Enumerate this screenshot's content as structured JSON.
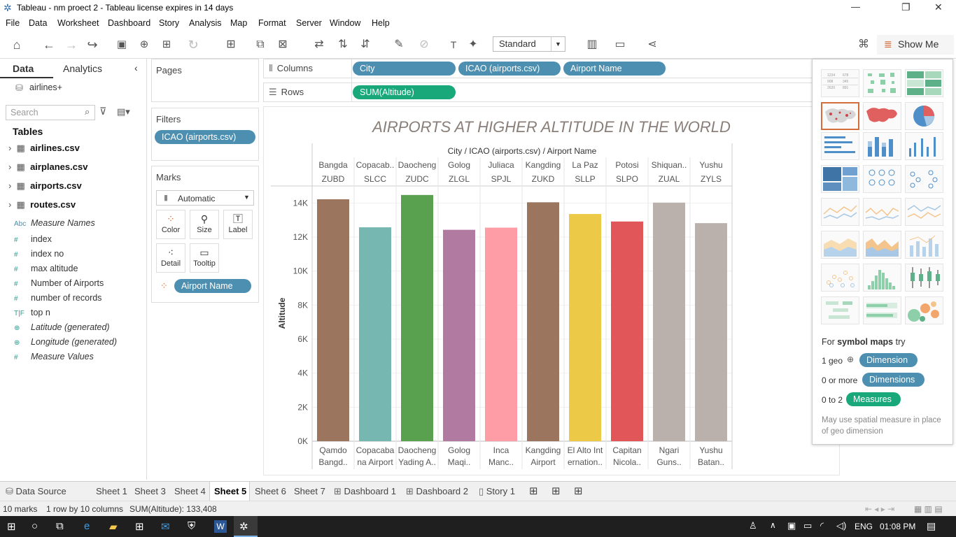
{
  "window": {
    "title": "Tableau - nm proect 2 - Tableau license expires in 14 days",
    "minimize": "—",
    "restore": "❐",
    "close": "✕"
  },
  "menu": [
    "File",
    "Data",
    "Worksheet",
    "Dashboard",
    "Story",
    "Analysis",
    "Map",
    "Format",
    "Server",
    "Window",
    "Help"
  ],
  "toolbar": {
    "fit_select": "Standard",
    "show_me_label": "Show Me"
  },
  "left_pane": {
    "tabs": [
      "Data",
      "Analytics"
    ],
    "datasource": "airlines+",
    "search_placeholder": "Search",
    "tables_heading": "Tables",
    "tables": [
      "airlines.csv",
      "airplanes.csv",
      "airports.csv",
      "routes.csv"
    ],
    "fields": [
      {
        "icon": "Abc",
        "label": "Measure Names",
        "italic": true
      },
      {
        "icon": "#",
        "label": "index",
        "italic": false
      },
      {
        "icon": "#",
        "label": "index no",
        "italic": false
      },
      {
        "icon": "#",
        "label": "max altitude",
        "italic": false
      },
      {
        "icon": "#",
        "label": "Number of Airports",
        "italic": false
      },
      {
        "icon": "#",
        "label": "number of records",
        "italic": false
      },
      {
        "icon": "T|F",
        "label": "top n",
        "italic": false
      },
      {
        "icon": "⊕",
        "label": "Latitude (generated)",
        "italic": true
      },
      {
        "icon": "⊕",
        "label": "Longitude (generated)",
        "italic": true
      },
      {
        "icon": "#",
        "label": "Measure Values",
        "italic": true
      }
    ]
  },
  "cards": {
    "pages": "Pages",
    "filters": "Filters",
    "filter_pill": "ICAO (airports.csv)",
    "marks": "Marks",
    "mark_type": "Automatic",
    "mark_buttons": [
      "Color",
      "Size",
      "Label",
      "Detail",
      "Tooltip"
    ],
    "color_pill": "Airport Name"
  },
  "shelves": {
    "columns_label": "Columns",
    "rows_label": "Rows",
    "columns": [
      "City",
      "ICAO (airports.csv)",
      "Airport Name"
    ],
    "rows": [
      "SUM(Altitude)"
    ]
  },
  "chart_data": {
    "type": "bar",
    "title": "AIRPORTS AT HIGHER ALTITUDE IN THE WORLD",
    "header_title": "City / ICAO (airports.csv) / Airport Name",
    "ylabel": "Altitude",
    "ylim": [
      0,
      15000
    ],
    "yticks": [
      "0K",
      "2K",
      "4K",
      "6K",
      "8K",
      "10K",
      "12K",
      "14K"
    ],
    "ytick_values": [
      0,
      2000,
      4000,
      6000,
      8000,
      10000,
      12000,
      14000
    ],
    "cities": [
      "Bangda",
      "Copacab..",
      "Daocheng",
      "Golog",
      "Juliaca",
      "Kangding",
      "La Paz",
      "Potosi",
      "Shiquan..",
      "Yushu"
    ],
    "icao": [
      "ZUBD",
      "SLCC",
      "ZUDC",
      "ZLGL",
      "SPJL",
      "ZUKD",
      "SLLP",
      "SLPO",
      "ZUAL",
      "ZYLS"
    ],
    "airport_line1": [
      "Qamdo",
      "Copacaba",
      "Daocheng",
      "Golog",
      "Inca",
      "Kangding",
      "El Alto Int",
      "Capitan",
      "Ngari",
      "Yushu"
    ],
    "airport_line2": [
      "Bangd..",
      "na Airport",
      "Yading A..",
      "Maqi..",
      "Manc..",
      "Airport",
      "ernation..",
      "Nicola..",
      "Guns..",
      "Batan.."
    ],
    "values": [
      14219,
      12572,
      14472,
      12426,
      12552,
      14042,
      13355,
      12913,
      14022,
      12816
    ],
    "colors": [
      "#9c755f",
      "#76b7b2",
      "#59a14f",
      "#b07aa1",
      "#ff9da7",
      "#9c755f",
      "#edc948",
      "#e15759",
      "#bab0ac",
      "#bab0ac"
    ]
  },
  "show_me": {
    "hint_prefix": "For ",
    "hint_bold": "symbol maps",
    "hint_suffix": " try",
    "rows": [
      {
        "label": "1 geo",
        "pill": "Dimension",
        "color": "#4d8fb0"
      },
      {
        "label": "0 or more",
        "pill": "Dimensions",
        "color": "#4d8fb0"
      },
      {
        "label": "0 to 2",
        "pill": "Measures",
        "color": "#19a87a"
      }
    ],
    "note": "May use spatial measure in place of geo dimension"
  },
  "sheet_tabs": [
    "Data Source",
    "Sheet 1",
    "Sheet 3",
    "Sheet 4",
    "Sheet 5",
    "Sheet 6",
    "Sheet 7",
    "Dashboard 1",
    "Dashboard 2",
    "Story 1"
  ],
  "active_tab": "Sheet 5",
  "status": {
    "marks": "10 marks",
    "layout": "1 row by 10 columns",
    "sum": "SUM(Altitude): 133,408"
  },
  "taskbar": {
    "language": "ENG",
    "time": "01:08 PM"
  }
}
